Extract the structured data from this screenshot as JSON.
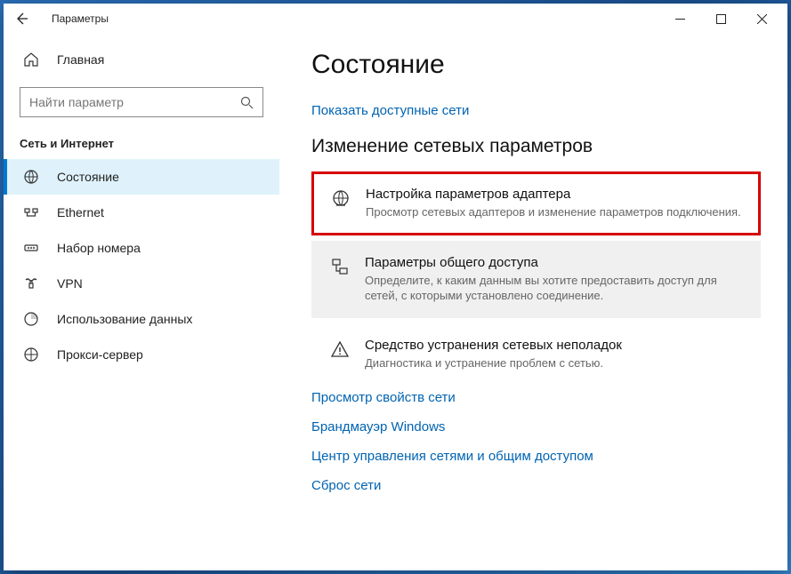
{
  "window": {
    "title": "Параметры"
  },
  "sidebar": {
    "home_label": "Главная",
    "search_placeholder": "Найти параметр",
    "section_title": "Сеть и Интернет",
    "items": [
      {
        "label": "Состояние"
      },
      {
        "label": "Ethernet"
      },
      {
        "label": "Набор номера"
      },
      {
        "label": "VPN"
      },
      {
        "label": "Использование данных"
      },
      {
        "label": "Прокси-сервер"
      }
    ]
  },
  "main": {
    "title": "Состояние",
    "show_networks_link": "Показать доступные сети",
    "subhead": "Изменение сетевых параметров",
    "options": [
      {
        "title": "Настройка параметров адаптера",
        "desc": "Просмотр сетевых адаптеров и изменение параметров подключения."
      },
      {
        "title": "Параметры общего доступа",
        "desc": "Определите, к каким данным вы хотите предоставить доступ для сетей, с которыми установлено соединение."
      },
      {
        "title": "Средство устранения сетевых неполадок",
        "desc": "Диагностика и устранение проблем с сетью."
      }
    ],
    "links": [
      "Просмотр свойств сети",
      "Брандмауэр Windows",
      "Центр управления сетями и общим доступом",
      "Сброс сети"
    ]
  }
}
